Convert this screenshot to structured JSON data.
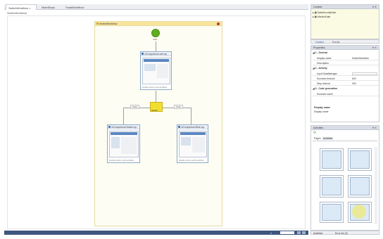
{
  "tabs": [
    "SwitchWorkflow",
    "MainSteps",
    "SmallWorkflow"
  ],
  "breadcrumb": "SwitchWorkflow",
  "flowchart": {
    "title": "SwitchWorkflow",
    "start_label": "Start",
    "switch_label": "Switch",
    "branch_left": "Case",
    "branch_right": "Case",
    "card_top_title": "uiComparisonLate.wp...",
    "card_left_title": "uiComparisonDetails.wp...",
    "card_right_title": "uiComparisonSlide.wp...",
    "card_footer": "Double-click to edit workflow"
  },
  "context": {
    "title": "Context",
    "items": [
      "DataSecurityDate",
      "MonitorDate"
    ]
  },
  "lower_tabs": [
    "Context",
    "Events"
  ],
  "properties": {
    "title": "Properties",
    "sections": [
      {
        "header": "1 - General",
        "rows": [
          {
            "key": "Display name",
            "value": "SwitchWorkflow"
          },
          {
            "key": "Description",
            "value": ""
          }
        ]
      },
      {
        "header": "2 - Activity",
        "rows": [
          {
            "key": "Input DataManager",
            "value": ""
          },
          {
            "key": "Scenario timeout",
            "value": "600"
          },
          {
            "key": "Step timeout",
            "value": "300"
          }
        ]
      },
      {
        "header": "3 - Code generation",
        "rows": [
          {
            "key": "Scenario name",
            "value": ""
          }
        ]
      }
    ],
    "help_title": "Display name",
    "help_text": "Display name"
  },
  "activities": {
    "title": "Activities",
    "tabs": [
      "Pages",
      "Activities"
    ]
  },
  "bottom_tabs": [
    "Activities",
    "Error list (0)"
  ],
  "colors": {
    "accent": "#3f567e",
    "start": "#5fae1e",
    "flow_header": "#f7e59b",
    "switch": "#f2de30",
    "highlight": "#efea9a"
  }
}
